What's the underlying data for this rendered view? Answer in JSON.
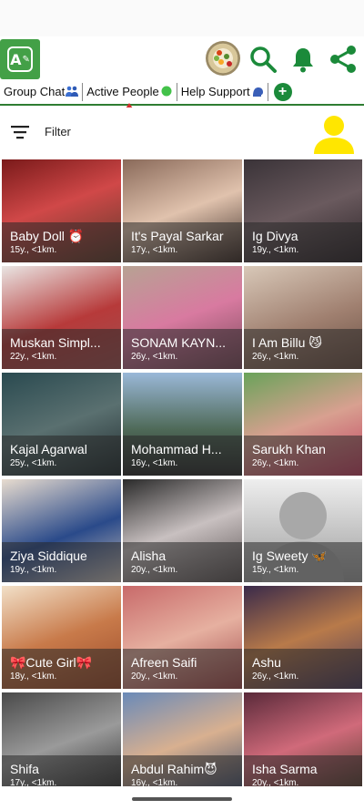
{
  "tabs": [
    {
      "label": "Group Chat",
      "emoji": "people"
    },
    {
      "label": "Active People",
      "emoji": "green-circle",
      "active": true
    },
    {
      "label": "Help Support",
      "emoji": "speaking-head"
    }
  ],
  "filter": {
    "label": "Filter"
  },
  "colors": {
    "accent": "#2e7d32",
    "overlay": "rgba(40,40,40,0.55)",
    "silhouette": "#ffe600"
  },
  "icons": [
    "app-logo-icon",
    "search-icon",
    "bell-icon",
    "share-icon",
    "filter-icon",
    "user-silhouette-icon",
    "add-icon"
  ],
  "profiles": [
    {
      "name": "Baby Doll ⏰",
      "meta": "15y., <1km."
    },
    {
      "name": "It's Payal Sarkar",
      "meta": "17y., <1km."
    },
    {
      "name": "Ig Divya",
      "meta": "19y., <1km."
    },
    {
      "name": "Muskan Simpl...",
      "meta": "22y., <1km."
    },
    {
      "name": "SONAM KAYN...",
      "meta": "26y., <1km."
    },
    {
      "name": "I Am Billu 😼",
      "meta": "26y., <1km."
    },
    {
      "name": "Kajal Agarwal",
      "meta": "25y., <1km."
    },
    {
      "name": "Mohammad H...",
      "meta": "16y., <1km."
    },
    {
      "name": "Sarukh Khan",
      "meta": "26y., <1km."
    },
    {
      "name": "Ziya Siddique",
      "meta": "19y., <1km."
    },
    {
      "name": "Alisha",
      "meta": "20y., <1km."
    },
    {
      "name": "Ig Sweety 🦋",
      "meta": "15y., <1km."
    },
    {
      "name": "🎀Cute Girl🎀",
      "meta": "18y., <1km."
    },
    {
      "name": "Afreen Saifi",
      "meta": "20y., <1km."
    },
    {
      "name": "Ashu",
      "meta": "26y., <1km."
    },
    {
      "name": "Shifa",
      "meta": "17y., <1km."
    },
    {
      "name": "Abdul Rahim😈",
      "meta": "16y., <1km."
    },
    {
      "name": "Isha Sarma",
      "meta": "20y., <1km."
    }
  ]
}
